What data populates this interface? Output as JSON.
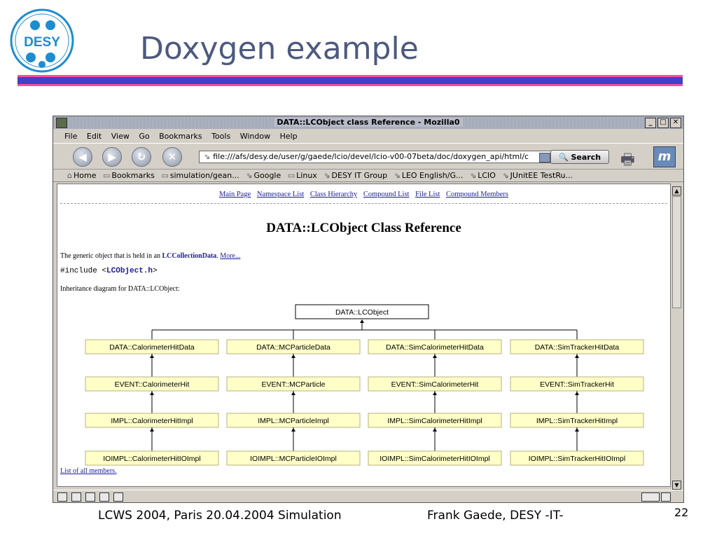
{
  "slide": {
    "title": "Doxygen example",
    "logo_text": "DESY",
    "footer_left": "LCWS 2004, Paris 20.04.2004 Simulation",
    "footer_right": "Frank Gaede, DESY -IT-",
    "page_number": "22"
  },
  "window": {
    "title": "DATA::LCObject class Reference - Mozilla0",
    "menu": [
      "File",
      "Edit",
      "View",
      "Go",
      "Bookmarks",
      "Tools",
      "Window",
      "Help"
    ],
    "url": "file:///afs/desy.de/user/g/gaede/lcio/devel/lcio-v00-07beta/doc/doxygen_api/html/c",
    "search_label": "Search",
    "bookmarks": [
      "Home",
      "Bookmarks",
      "simulation/gean...",
      "Google",
      "Linux",
      "DESY IT Group",
      "LEO English/G...",
      "LCIO",
      "JUnitEE TestRu..."
    ]
  },
  "page": {
    "nav_links": [
      "Main Page",
      "Namespace List",
      "Class Hierarchy",
      "Compound List",
      "File List",
      "Compound Members"
    ],
    "heading": "DATA::LCObject Class Reference",
    "desc_prefix": "The generic object that is held in an ",
    "desc_link": "LCCollectionData",
    "desc_more": "More...",
    "include_prefix": "#include <",
    "include_file": "LCObject.h",
    "include_suffix": ">",
    "inheritance_caption": "Inheritance diagram for DATA::LCObject:",
    "list_all": "List of all members."
  },
  "diagram": {
    "root": "DATA::LCObject",
    "columns": [
      [
        "DATA::CalorimeterHitData",
        "EVENT::CalorimeterHit",
        "IMPL::CalorimeterHitImpl",
        "IOIMPL::CalorimeterHitIOImpl"
      ],
      [
        "DATA::MCParticleData",
        "EVENT::MCParticle",
        "IMPL::MCParticleImpl",
        "IOIMPL::MCParticleIOImpl"
      ],
      [
        "DATA::SimCalorimeterHitData",
        "EVENT::SimCalorimeterHit",
        "IMPL::SimCalorimeterHitImpl",
        "IOIMPL::SimCalorimeterHitIOImpl"
      ],
      [
        "DATA::SimTrackerHitData",
        "EVENT::SimTrackerHit",
        "IMPL::SimTrackerHitImpl",
        "IOIMPL::SimTrackerHitIOImpl"
      ]
    ]
  },
  "colors": {
    "title": "#4d5a7e",
    "bar_blue": "#4040c8",
    "bar_pink": "#ff4da6",
    "box_fill": "#ffffc8",
    "link": "#1a1aa0"
  }
}
